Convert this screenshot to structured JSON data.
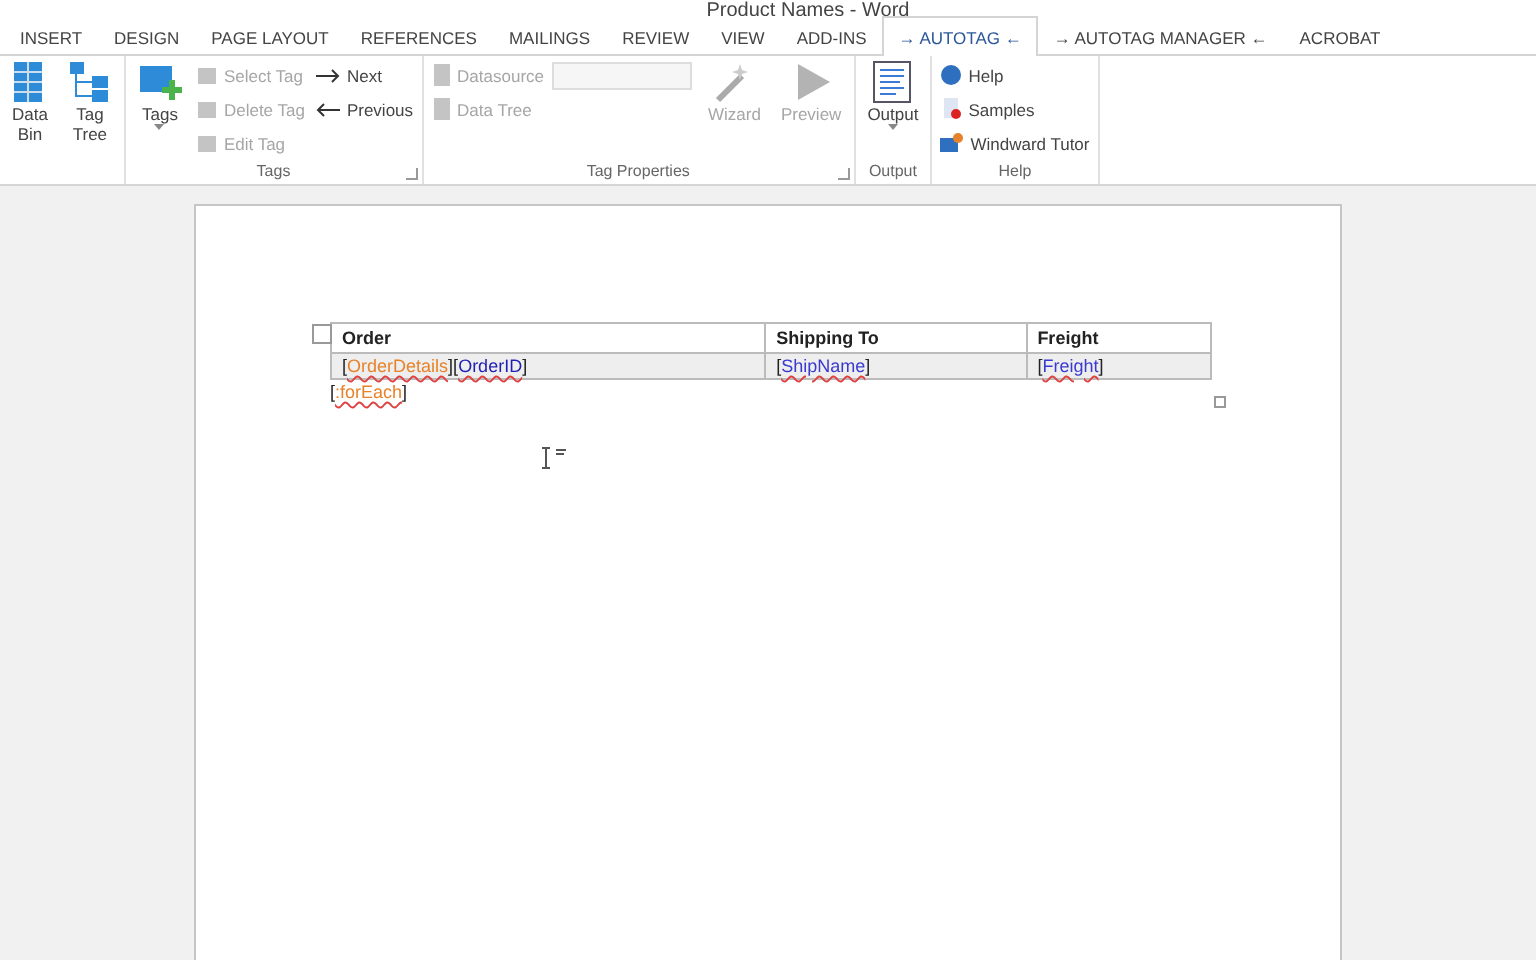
{
  "window": {
    "title": "Product Names - Word"
  },
  "tabs": [
    {
      "label": "INSERT",
      "selected": false
    },
    {
      "label": "DESIGN",
      "selected": false
    },
    {
      "label": "PAGE LAYOUT",
      "selected": false
    },
    {
      "label": "REFERENCES",
      "selected": false
    },
    {
      "label": "MAILINGS",
      "selected": false
    },
    {
      "label": "REVIEW",
      "selected": false
    },
    {
      "label": "VIEW",
      "selected": false
    },
    {
      "label": "ADD-INS",
      "selected": false
    },
    {
      "label": "→ AUTOTAG ←",
      "selected": true
    },
    {
      "label": "→ AUTOTAG MANAGER ←",
      "selected": false
    },
    {
      "label": "ACROBAT",
      "selected": false
    }
  ],
  "ribbon": {
    "groups": [
      {
        "launcher": false,
        "columns": [
          [
            {
              "kind": "large",
              "label": "Data\nBin",
              "disabled": false
            }
          ],
          [
            {
              "kind": "large",
              "label": "Tag\nTree",
              "disabled": false
            }
          ]
        ]
      },
      {
        "label": "Tags",
        "launcher": true,
        "columns": [
          [
            {
              "kind": "large",
              "label": "Tags",
              "dropdown": true,
              "disabled": false
            }
          ],
          [
            {
              "kind": "small",
              "label": "Select Tag",
              "disabled": true
            },
            {
              "kind": "small",
              "label": "Delete Tag",
              "disabled": true
            },
            {
              "kind": "small",
              "label": "Edit Tag",
              "disabled": true
            }
          ],
          [
            {
              "kind": "small",
              "label": "Next",
              "disabled": false
            },
            {
              "kind": "small",
              "label": "Previous",
              "disabled": false
            }
          ]
        ]
      },
      {
        "label": "Tag Properties",
        "launcher": true,
        "columns": [
          [
            {
              "kind": "combo",
              "label": "Datasource",
              "disabled": true
            },
            {
              "kind": "small",
              "label": "Data Tree",
              "disabled": true
            }
          ],
          [
            {
              "kind": "large",
              "label": "Wizard",
              "disabled": true
            }
          ],
          [
            {
              "kind": "large",
              "label": "Preview",
              "disabled": true
            }
          ]
        ]
      },
      {
        "label": "Output",
        "launcher": false,
        "columns": [
          [
            {
              "kind": "large",
              "label": "Output",
              "dropdown": true,
              "disabled": false
            }
          ]
        ]
      },
      {
        "label": "Help",
        "launcher": false,
        "columns": [
          [
            {
              "kind": "small",
              "label": "Help",
              "disabled": false
            },
            {
              "kind": "small",
              "label": "Samples",
              "disabled": false
            },
            {
              "kind": "small",
              "label": "Windward Tutor",
              "disabled": false
            }
          ]
        ]
      }
    ]
  },
  "document": {
    "table": {
      "columns": [
        "Order",
        "Shipping To",
        "Freight"
      ],
      "rows": [
        [
          [
            {
              "open": "[",
              "name": "OrderDetails",
              "close": "]",
              "color": "#e8822a"
            },
            {
              "open": "[",
              "name": "OrderID",
              "close": "]",
              "color": "#1f1fb4"
            }
          ],
          [
            {
              "open": "[",
              "name": "ShipName",
              "close": "]",
              "color": "#3a3ad0"
            }
          ],
          [
            {
              "open": "[",
              "name": "Freight",
              "close": "]",
              "color": "#3a3ad0"
            }
          ]
        ]
      ]
    },
    "after": [
      {
        "open": "[",
        "name": ":forEach",
        "close": "]",
        "color": "#e8822a"
      }
    ]
  }
}
